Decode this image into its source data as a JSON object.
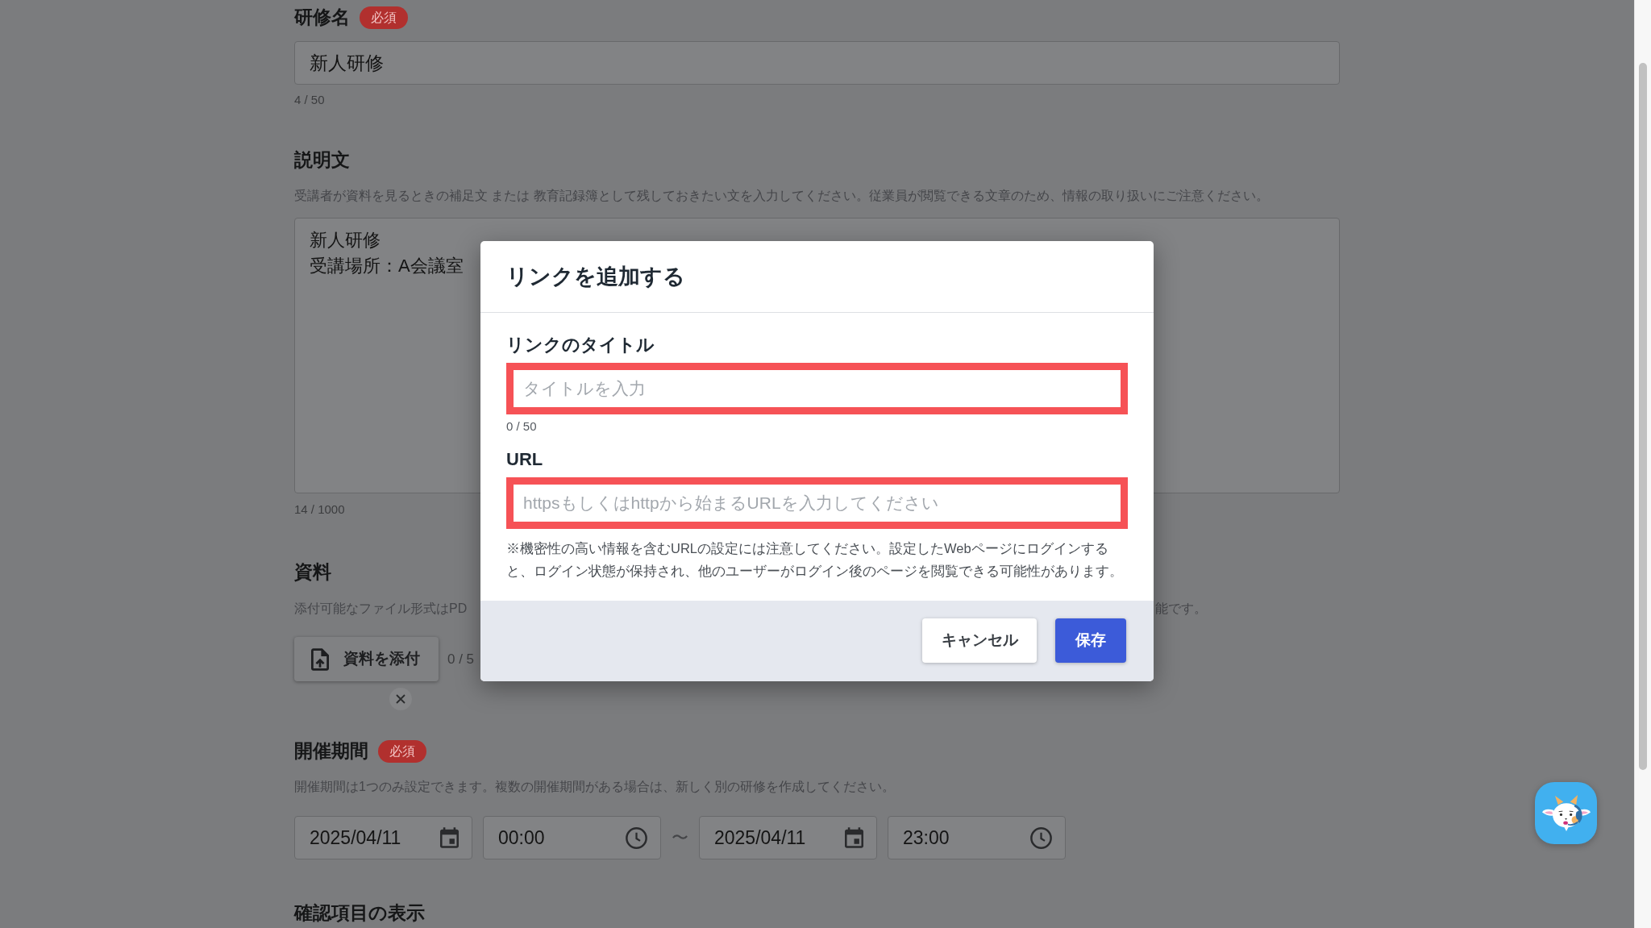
{
  "page": {
    "sections": [
      {
        "kind": "text",
        "label": "研修名",
        "badge": "必須",
        "value": "新人研修",
        "counter": "4 / 50"
      },
      {
        "kind": "textarea",
        "label": "説明文",
        "help": "受講者が資料を見るときの補足文 または 教育記録簿として残しておきたい文を入力してください。従業員が閲覧できる文章のため、情報の取り扱いにご注意ください。",
        "lines": [
          "新人研修",
          "受講場所：A会議室"
        ],
        "counter": "14 / 1000"
      },
      {
        "kind": "attachment",
        "label": "資料",
        "help_fragments": [
          "添付可能なファイル形式はPD",
          "能です。"
        ],
        "button": "資料を添付",
        "count": "0 / 5"
      },
      {
        "kind": "period",
        "label": "開催期間",
        "badge": "必須",
        "help": "開催期間は1つのみ設定できます。複数の開催期間がある場合は、新しく別の研修を作成してください。",
        "inputs": [
          {
            "kind": "date",
            "value": "2025/04/11"
          },
          {
            "kind": "time",
            "value": "00:00"
          },
          {
            "kind": "separator",
            "text": "〜"
          },
          {
            "kind": "date",
            "value": "2025/04/11"
          },
          {
            "kind": "time",
            "value": "23:00"
          }
        ]
      },
      {
        "kind": "heading",
        "label": "確認項目の表示"
      }
    ]
  },
  "modal": {
    "title": "リンクを追加する",
    "fields": [
      {
        "label": "リンクのタイトル",
        "placeholder": "タイトルを入力",
        "highlighted": true,
        "counter": "0 / 50"
      },
      {
        "label": "URL",
        "placeholder": "httpsもしくはhttpから始まるURLを入力してください",
        "highlighted": true
      }
    ],
    "note": "※機密性の高い情報を含むURLの設定には注意してください。設定したWebページにログインすると、ログイン状態が保持され、他のユーザーがログイン後のページを閲覧できる可能性があります。",
    "buttons": [
      {
        "kind": "secondary",
        "label": "キャンセル"
      },
      {
        "kind": "primary",
        "label": "保存"
      }
    ]
  }
}
